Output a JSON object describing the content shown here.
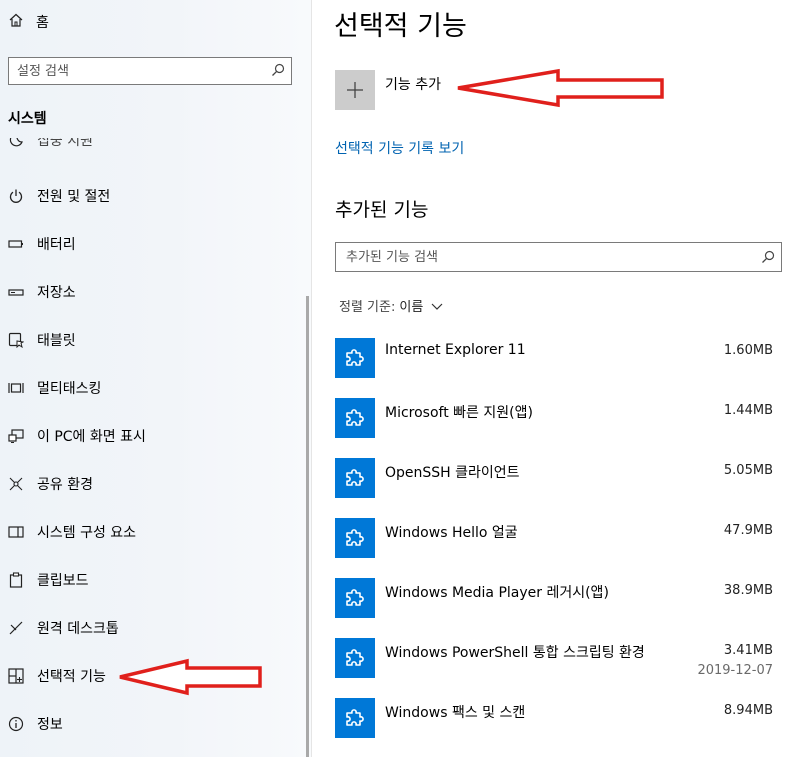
{
  "sidebar": {
    "home_label": "홈",
    "search_placeholder": "설정 검색",
    "section_title": "시스템",
    "partial_item_label": "집중 지원",
    "items": [
      {
        "label": "전원 및 절전",
        "icon": "power-icon"
      },
      {
        "label": "배터리",
        "icon": "battery-icon"
      },
      {
        "label": "저장소",
        "icon": "storage-icon"
      },
      {
        "label": "태블릿",
        "icon": "tablet-icon"
      },
      {
        "label": "멀티태스킹",
        "icon": "multitasking-icon"
      },
      {
        "label": "이 PC에 화면 표시",
        "icon": "project-icon"
      },
      {
        "label": "공유 환경",
        "icon": "shared-experiences-icon"
      },
      {
        "label": "시스템 구성 요소",
        "icon": "system-components-icon"
      },
      {
        "label": "클립보드",
        "icon": "clipboard-icon"
      },
      {
        "label": "원격 데스크톱",
        "icon": "remote-desktop-icon"
      },
      {
        "label": "선택적 기능",
        "icon": "optional-features-icon"
      },
      {
        "label": "정보",
        "icon": "info-icon"
      }
    ]
  },
  "main": {
    "title": "선택적 기능",
    "add_feature_label": "기능 추가",
    "history_link": "선택적 기능 기록 보기",
    "installed_title": "추가된 기능",
    "search_placeholder": "추가된 기능 검색",
    "sort_label": "정렬 기준:",
    "sort_value": "이름",
    "features": [
      {
        "name": "Internet Explorer 11",
        "size": "1.60MB",
        "date": ""
      },
      {
        "name": "Microsoft 빠른 지원(앱)",
        "size": "1.44MB",
        "date": ""
      },
      {
        "name": "OpenSSH 클라이언트",
        "size": "5.05MB",
        "date": ""
      },
      {
        "name": "Windows Hello 얼굴",
        "size": "47.9MB",
        "date": ""
      },
      {
        "name": "Windows Media Player 레거시(앱)",
        "size": "38.9MB",
        "date": ""
      },
      {
        "name": "Windows PowerShell 통합 스크립팅 환경",
        "size": "3.41MB",
        "date": "2019-12-07"
      },
      {
        "name": "Windows 팩스 및 스캔",
        "size": "8.94MB",
        "date": ""
      }
    ]
  },
  "colors": {
    "accent": "#0078d7",
    "link": "#0063b1",
    "arrow": "#e0201c",
    "add_button_bg": "#cccccc"
  }
}
